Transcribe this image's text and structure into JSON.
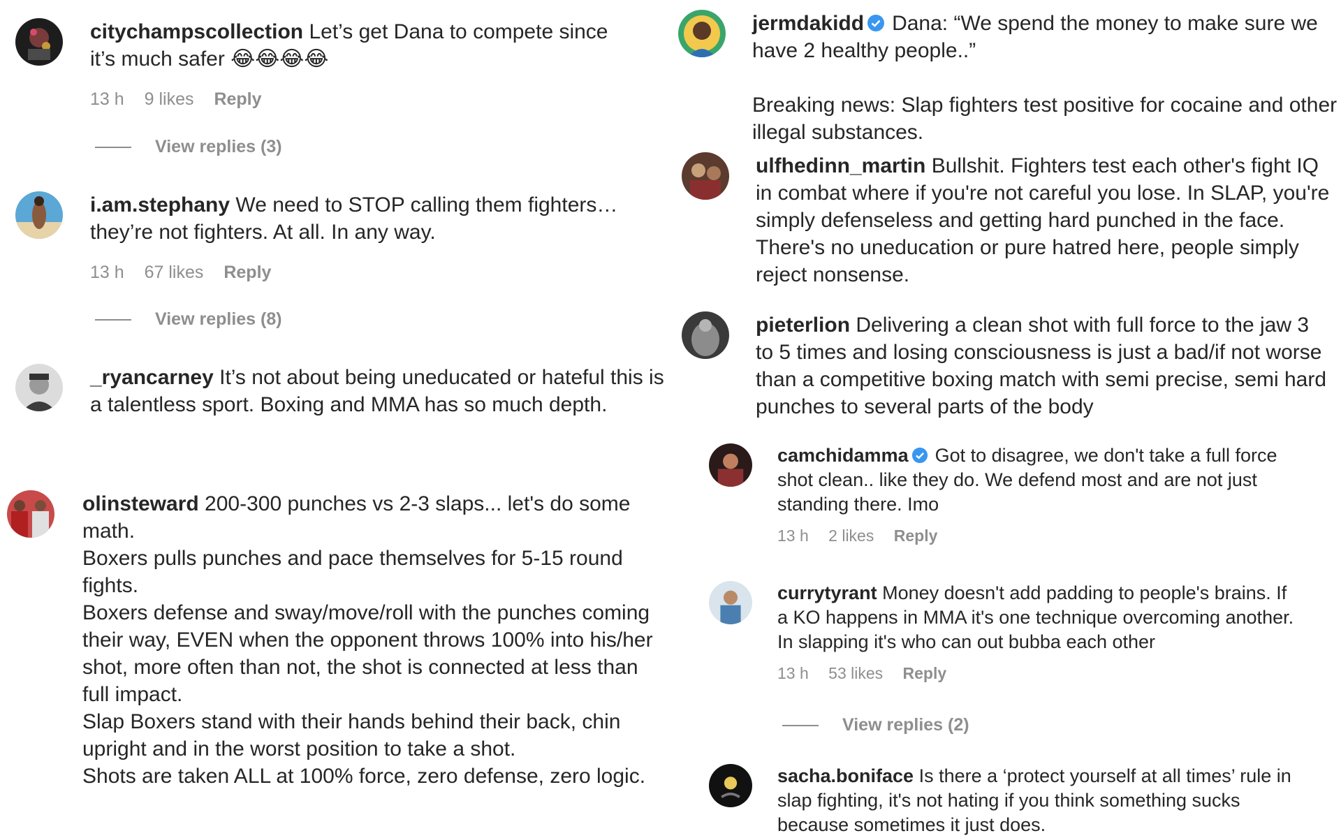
{
  "left": {
    "comments": [
      {
        "username": "citychampscollection",
        "text": "Let’s get Dana to compete since it’s much safer 😂😂😂😂",
        "time": "13 h",
        "likes": "9 likes",
        "reply": "Reply",
        "view_replies": "View replies (3)"
      },
      {
        "username": "i.am.stephany",
        "text": "We need to STOP calling them fighters… they’re not fighters. At all. In any way.",
        "time": "13 h",
        "likes": "67 likes",
        "reply": "Reply",
        "view_replies": "View replies (8)"
      },
      {
        "username": "_ryancarney",
        "text": "It’s not about being uneducated or hateful this is a talentless sport. Boxing and MMA has so much depth."
      },
      {
        "username": "olinsteward",
        "text": "200-300 punches vs 2-3 slaps... let's do some math.\nBoxers pulls punches and pace themselves for 5-15 round fights.\nBoxers defense and sway/move/roll with the punches coming their way, EVEN when the opponent throws 100% into his/her shot, more often than not, the shot is connected at less than full impact.\nSlap Boxers stand with their hands behind their back, chin upright and in the worst position to take a shot.\nShots are taken ALL at 100% force, zero defense, zero logic."
      }
    ]
  },
  "right": {
    "comments": [
      {
        "username": "jermdakidd",
        "verified": true,
        "text": "Dana: “We spend the money to make sure we have 2 healthy people..”\n\nBreaking news: Slap fighters test positive for cocaine and other illegal substances."
      },
      {
        "username": "ulfhedinn_martin",
        "text": "Bullshit. Fighters test each other's fight IQ in combat where if you're not careful you lose. In SLAP, you're simply defenseless and getting hard punched in the face. There's no uneducation or pure hatred here, people simply reject nonsense."
      },
      {
        "username": "pieterlion",
        "text": "Delivering a clean shot with full force to the jaw 3 to 5 times and losing consciousness is just a bad/if not worse than a competitive boxing match with semi precise, semi hard punches to several parts of the body"
      },
      {
        "username": "camchidamma",
        "verified": true,
        "text": "Got to disagree, we don't take a full force shot clean.. like they do. We defend most and are not just standing there. Imo",
        "time": "13 h",
        "likes": "2 likes",
        "reply": "Reply"
      },
      {
        "username": "currytyrant",
        "text": "Money doesn't add padding to people's brains. If a KO happens in MMA it's one technique overcoming another. In slapping it's who can out bubba each other",
        "time": "13 h",
        "likes": "53 likes",
        "reply": "Reply",
        "view_replies": "View replies (2)"
      },
      {
        "username": "sacha.boniface",
        "text": "Is there a ‘protect yourself at all times’ rule in slap fighting, it's not hating if you think something sucks because sometimes it just does."
      }
    ]
  },
  "colors": {
    "text": "#262626",
    "muted": "#8e8e8e",
    "verified": "#3897f0"
  }
}
